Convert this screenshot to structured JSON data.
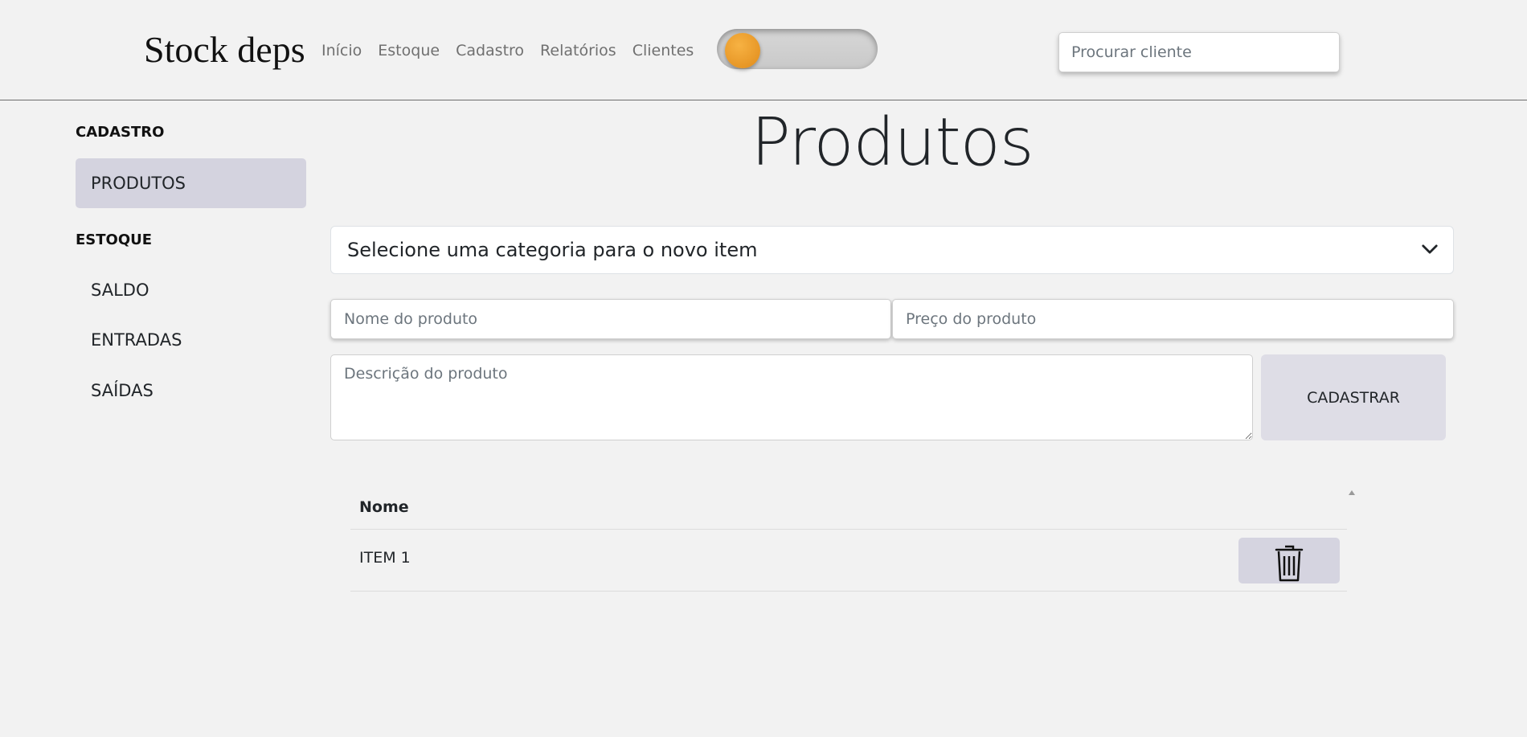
{
  "header": {
    "brand": "Stock deps",
    "nav": [
      "Início",
      "Estoque",
      "Cadastro",
      "Relatórios",
      "Clientes"
    ],
    "theme_toggle": "off",
    "client_search_placeholder": "Procurar cliente"
  },
  "sidebar": {
    "sections": [
      {
        "heading": "CADASTRO",
        "items": [
          {
            "label": "PRODUTOS",
            "active": true
          }
        ]
      },
      {
        "heading": "ESTOQUE",
        "items": [
          {
            "label": "SALDO",
            "active": false
          },
          {
            "label": "ENTRADAS",
            "active": false
          },
          {
            "label": "SAÍDAS",
            "active": false
          }
        ]
      }
    ]
  },
  "main": {
    "title": "Produtos",
    "category_select_value": "Selecione uma categoria para o novo item",
    "name_placeholder": "Nome do produto",
    "price_placeholder": "Preço do produto",
    "description_placeholder": "Descrição do produto",
    "submit_label": "CADASTRAR"
  },
  "table": {
    "columns": [
      "Nome"
    ],
    "rows": [
      {
        "name": "ITEM 1"
      }
    ]
  },
  "icons": {
    "dropdown": "chevron-down-icon",
    "sort": "sort-up-icon",
    "delete": "trash-icon",
    "toggle": "theme-toggle"
  },
  "colors": {
    "background": "#f2f2f2",
    "sidebar_active": "#d4d3df",
    "button": "#dedde6",
    "toggle_knob": "#eb9a2c"
  }
}
